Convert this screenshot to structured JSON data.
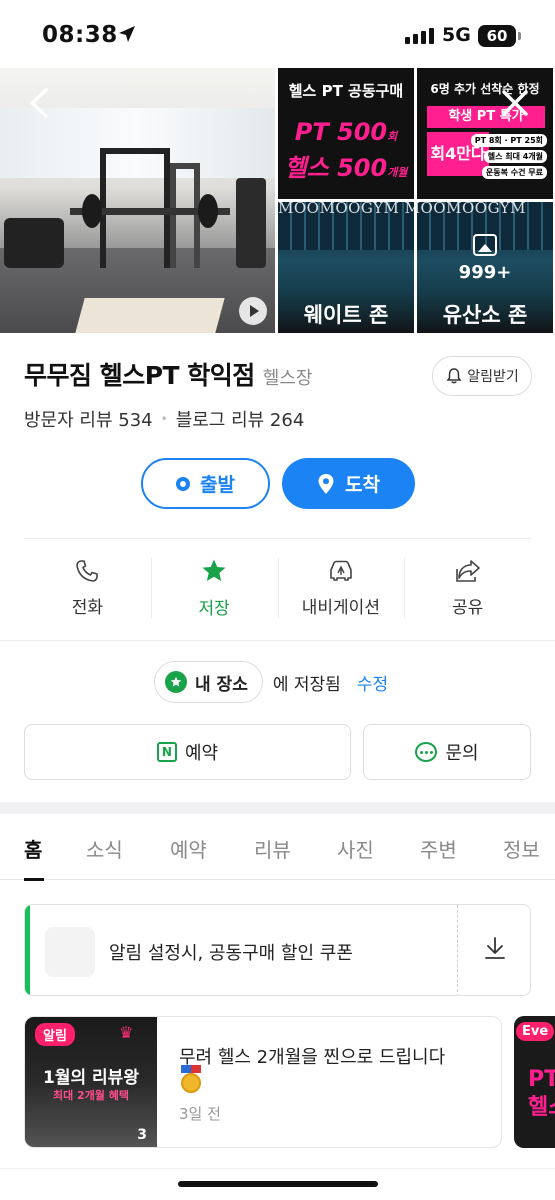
{
  "status_bar": {
    "time": "08:38",
    "network": "5G",
    "battery": "60"
  },
  "gallery": {
    "tiles": {
      "poster1": {
        "heading": "헬스 PT 공동구매",
        "line1": "PT 500",
        "line1_unit": "회",
        "line2": "헬스 500",
        "line2_unit": "개월",
        "zone": "웨이트 존"
      },
      "poster2": {
        "heading": "6명 추가 선착순 한정",
        "highlight": "학생 PT 특가",
        "price": "회4만다",
        "tag1": "PT 8회 · PT 25회",
        "tag2": "헬스 최대 4개월",
        "tag3": "운동복 수건 무료"
      },
      "gym2": {
        "more_count": "999+",
        "zone": "유산소 존"
      }
    },
    "watermark": "MOOMOOGYM MOOMOOGYM"
  },
  "place": {
    "name": "무무짐 헬스PT 학익점",
    "category": "헬스장",
    "alarm_button": "알림받기",
    "visitor_reviews": "방문자 리뷰 534",
    "blog_reviews": "블로그 리뷰 264"
  },
  "directions": {
    "start": "출발",
    "arrive": "도착"
  },
  "actions": {
    "call": "전화",
    "save": "저장",
    "navigate": "내비게이션",
    "share": "공유"
  },
  "saved": {
    "chip": "내 장소",
    "text": "에 저장됨",
    "edit": "수정"
  },
  "buttons": {
    "booking": "예약",
    "inquiry": "문의"
  },
  "tabs": [
    "홈",
    "소식",
    "예약",
    "리뷰",
    "사진",
    "주변",
    "정보"
  ],
  "coupon": {
    "text": "알림 설정시, 공동구매 할인 쿠폰"
  },
  "news": {
    "thumb_tag": "알림",
    "thumb_headline": "1월의 리뷰왕",
    "thumb_sub": "최대 2개월 혜택",
    "thumb_count": "3",
    "title": "무려 헬스 2개월을 찐으로 드립니다",
    "date": "3일 전"
  },
  "news2": {
    "tag": "Eve",
    "text": "PT 헬스"
  },
  "colors": {
    "primary": "#1c83f5",
    "green": "#1aa24a",
    "pink": "#ff1f8e"
  }
}
